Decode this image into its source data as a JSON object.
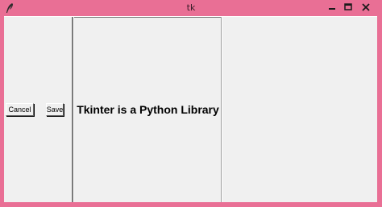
{
  "window": {
    "title": "tk",
    "controls": {
      "minimize_icon": "minimize-icon",
      "maximize_icon": "maximize-icon",
      "close_icon": "close-icon"
    }
  },
  "left_panel": {
    "cancel_label": "Cancel",
    "save_label": "Save"
  },
  "middle_panel": {
    "label_text": "Tkinter is a Python Library"
  },
  "colors": {
    "titlebar": "#e96f95",
    "client_bg": "#f0f0f0"
  }
}
